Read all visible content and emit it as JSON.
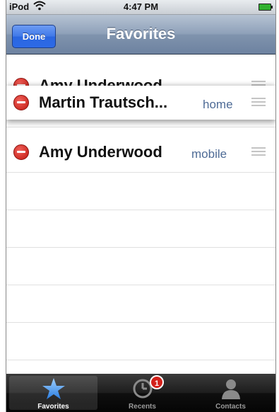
{
  "status_bar": {
    "carrier": "iPod",
    "time": "4:47 PM"
  },
  "nav": {
    "title": "Favorites",
    "done_label": "Done"
  },
  "favorites": [
    {
      "name": "Amy Underwood",
      "label": ""
    },
    {
      "name": "Martin Trautsch...",
      "label": "home"
    },
    {
      "name": "Amy Underwood",
      "label": "mobile"
    }
  ],
  "tabs": [
    {
      "label": "Favorites",
      "icon": "star-icon",
      "selected": true
    },
    {
      "label": "Recents",
      "icon": "clock-icon",
      "badge": "1"
    },
    {
      "label": "Contacts",
      "icon": "person-icon"
    }
  ],
  "colors": {
    "accent_blue": "#2d6ae6",
    "delete_red": "#c1180f",
    "label_blue": "#4e6b96",
    "badge_red": "#d3201a"
  }
}
